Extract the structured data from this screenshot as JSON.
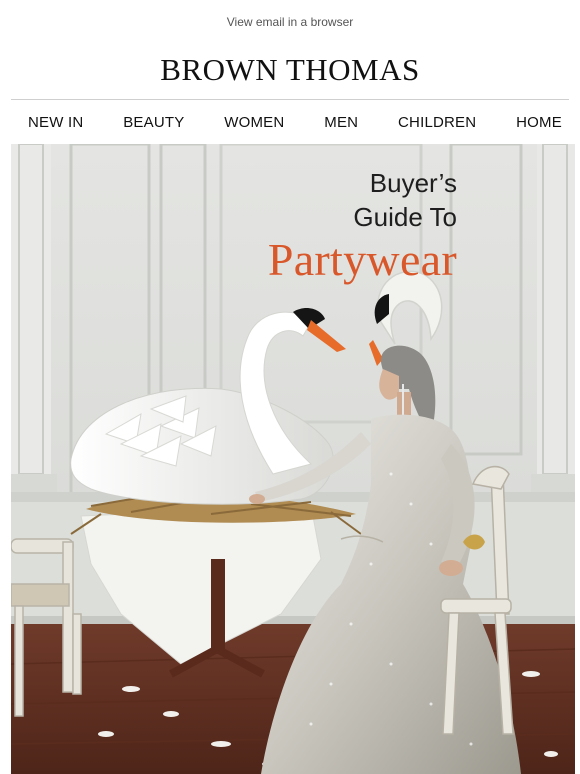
{
  "header": {
    "view_in_browser": "View email in a browser",
    "brand": "BROWN THOMAS"
  },
  "nav": {
    "items": [
      {
        "label": "NEW IN",
        "name": "nav-item-new-in"
      },
      {
        "label": "BEAUTY",
        "name": "nav-item-beauty"
      },
      {
        "label": "WOMEN",
        "name": "nav-item-women"
      },
      {
        "label": "MEN",
        "name": "nav-item-men"
      },
      {
        "label": "CHILDREN",
        "name": "nav-item-children"
      },
      {
        "label": "HOME",
        "name": "nav-item-home"
      }
    ]
  },
  "hero": {
    "line1": "Buyer’s",
    "line2": "Guide To",
    "accent": "Partywear"
  },
  "colors": {
    "accent": "#d9582b",
    "text": "#111111",
    "link_muted": "#555555",
    "divider": "#cfcfcf"
  }
}
